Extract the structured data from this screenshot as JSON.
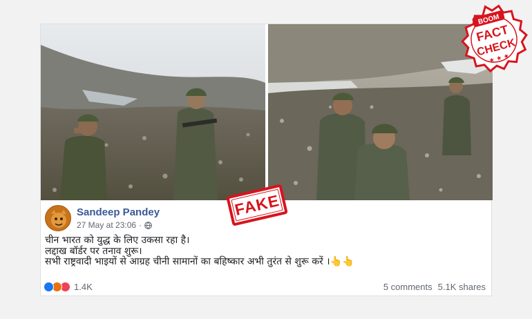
{
  "post": {
    "author": "Sandeep Pandey",
    "timestamp": "27 May at 23:06",
    "lines": [
      "चीन भारत को युद्ध के लिए उकसा रहा है।",
      "लद्दाख बॉर्डर पर तनाव शुरू।",
      "सभी राष्ट्रवादी भाइयों से आग्रह चीनी सामानों का बहिष्कार अभी तुरंत से शुरू करें ।👆👆"
    ],
    "reaction_count": "1.4K",
    "comments": "5 comments",
    "shares": "5.1K shares",
    "reactions": [
      "like-icon",
      "angry-icon",
      "love-icon"
    ]
  },
  "stamp": {
    "label": "FAKE",
    "color": "#d7141d"
  },
  "badge": {
    "top": "BOOM",
    "line1": "FACT",
    "line2": "CHECK",
    "stars": "★ ★ ★",
    "color": "#d7141d"
  },
  "colors": {
    "author": "#385898",
    "like": "#1877f2",
    "angry": "#e9710f",
    "love": "#f33e58"
  }
}
